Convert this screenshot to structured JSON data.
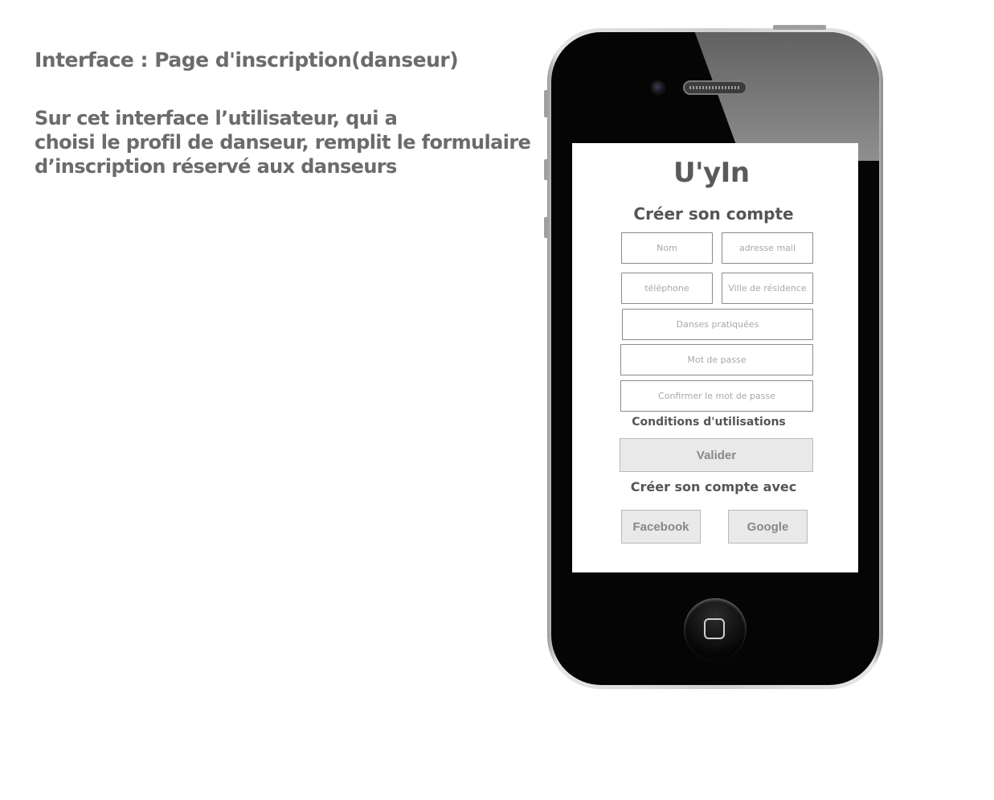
{
  "description": {
    "title": "Interface : Page d'inscription(danseur)",
    "lines": [
      "Sur cet interface l’utilisateur, qui a",
      "choisi le profil de danseur, remplit le formulaire",
      "d’inscription réservé aux danseurs"
    ]
  },
  "app": {
    "logo": "U'yIn",
    "heading": "Créer son compte",
    "fields": {
      "nom": "Nom",
      "email": "adresse mail",
      "telephone": "téléphone",
      "ville": "Ville de résidence",
      "danses": "Danses pratiquées",
      "password": "Mot de passe",
      "confirm_password": "Confirmer le mot de passe"
    },
    "terms_link": "Conditions d'utilisations",
    "submit_label": "Valider",
    "social_heading": "Créer son compte avec",
    "social": {
      "facebook": "Facebook",
      "google": "Google"
    }
  }
}
